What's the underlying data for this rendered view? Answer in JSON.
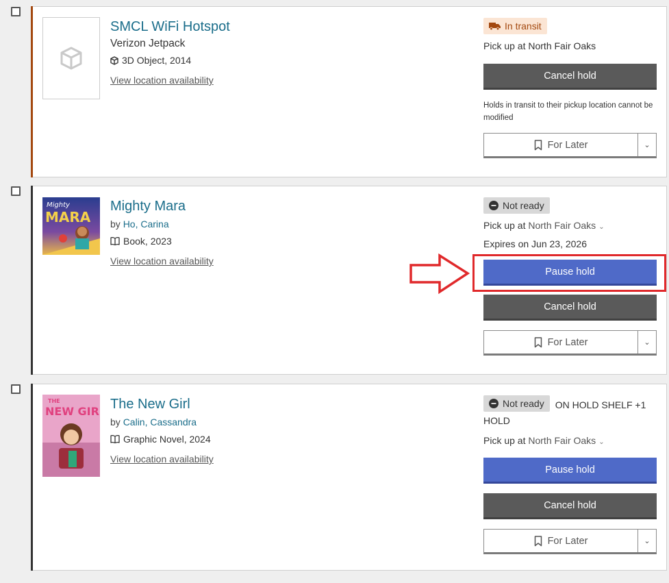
{
  "holds": [
    {
      "title": "SMCL WiFi Hotspot",
      "subtitle": "Verizon Jetpack",
      "format": "3D Object, 2014",
      "availability_link": "View location availability",
      "status": "In transit",
      "pickup_text": "Pick up at North Fair Oaks",
      "cancel_label": "Cancel hold",
      "note": "Holds in transit to their pickup location cannot be modified",
      "for_later_label": "For Later",
      "accent_color": "#a3480f",
      "icon": "cube-icon"
    },
    {
      "title": "Mighty Mara",
      "by_prefix": "by",
      "author": "Ho, Carina",
      "format": "Book, 2023",
      "availability_link": "View location availability",
      "status": "Not ready",
      "pickup_prefix": "Pick up at",
      "pickup_location": "North Fair Oaks",
      "expires": "Expires on Jun 23, 2026",
      "pause_label": "Pause hold",
      "cancel_label": "Cancel hold",
      "for_later_label": "For Later",
      "accent_color": "#333333",
      "icon": "book-icon"
    },
    {
      "title": "The New Girl",
      "by_prefix": "by",
      "author": "Calin, Cassandra",
      "format": "Graphic Novel, 2024",
      "availability_link": "View location availability",
      "status": "Not ready",
      "status_extra": "ON HOLD SHELF +1 HOLD",
      "pickup_prefix": "Pick up at",
      "pickup_location": "North Fair Oaks",
      "pause_label": "Pause hold",
      "cancel_label": "Cancel hold",
      "for_later_label": "For Later",
      "accent_color": "#333333",
      "icon": "book-icon"
    }
  ],
  "colors": {
    "link": "#1a6d8a",
    "pause_button": "#4f6ac8",
    "cancel_button": "#5a5a5a",
    "annotation": "#e0292b"
  }
}
